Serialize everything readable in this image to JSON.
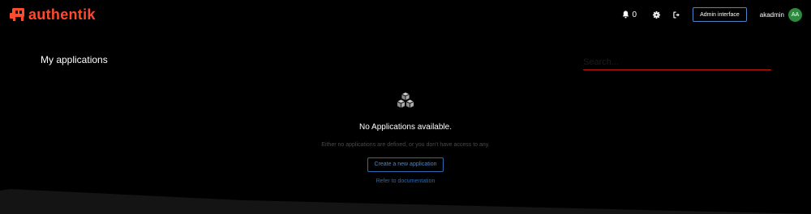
{
  "brand": {
    "logo_text": "authentik",
    "accent": "#fd4b2d"
  },
  "header": {
    "notification_count": "0",
    "admin_button_label": "Admin interface",
    "username": "akadmin",
    "avatar_initials": "AA",
    "avatar_color": "#2b8a3e",
    "icons": [
      "bell-icon",
      "gear-icon",
      "logout-icon"
    ]
  },
  "main": {
    "title": "My applications",
    "search_placeholder": "Search...",
    "search_underline_color": "#c9190b"
  },
  "empty_state": {
    "icon": "cubes-icon",
    "title": "No Applications available.",
    "description": "Either no applications are defined, or you don't have access to any.",
    "create_button_label": "Create a new application",
    "docs_link_label": "Refer to documentation",
    "link_color": "#2b6ab0"
  }
}
